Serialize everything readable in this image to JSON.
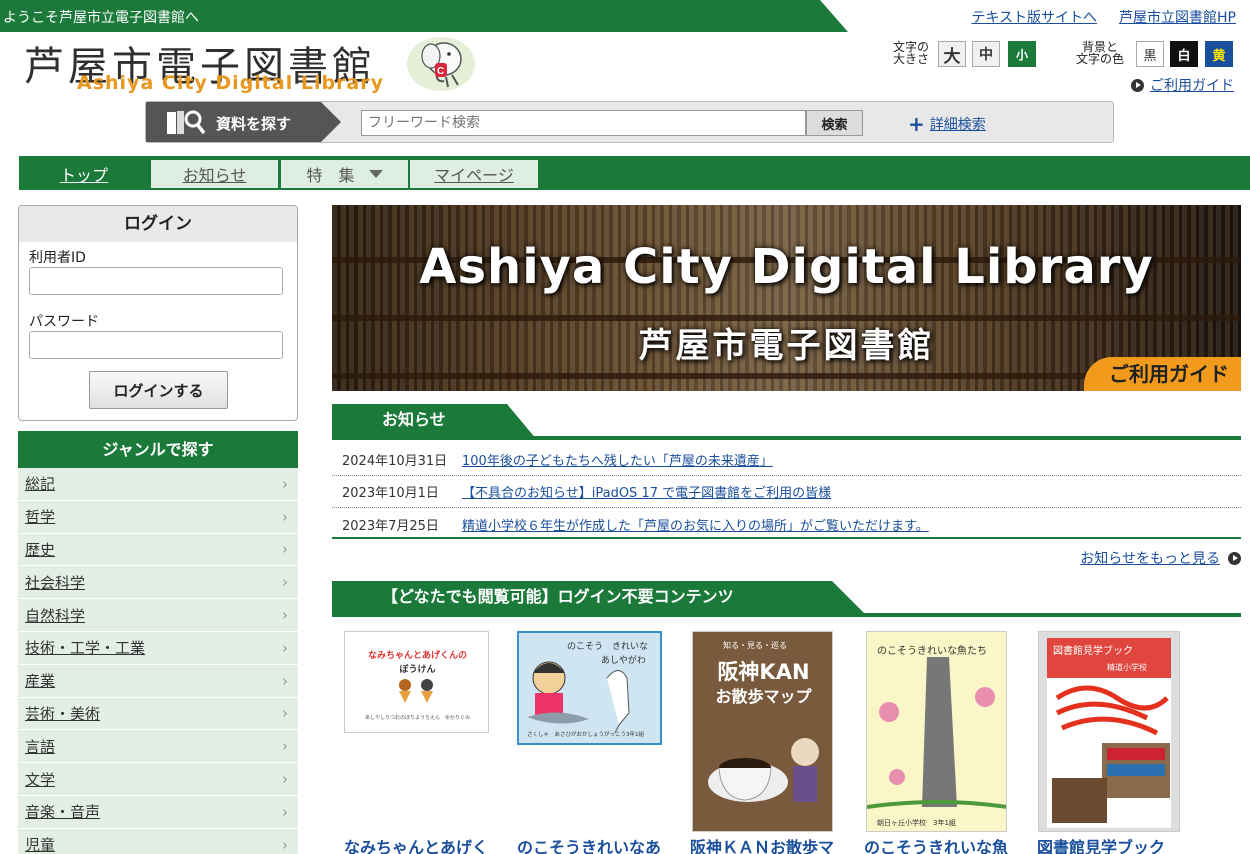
{
  "header": {
    "welcome": "ようこそ芦屋市立電子図書館へ",
    "links": [
      "テキスト版サイトへ",
      "芦屋市立図書館HP"
    ],
    "logo_jp": "芦屋市電子図書館",
    "logo_en": "Ashiya City Digital Library"
  },
  "display_controls": {
    "size_label_1": "文字の",
    "size_label_2": "大きさ",
    "sizes": [
      "大",
      "中",
      "小"
    ],
    "color_label_1": "背景と",
    "color_label_2": "文字の色",
    "colors": [
      "黒",
      "白",
      "黄"
    ],
    "guide": "ご利用ガイド"
  },
  "search": {
    "label": "資料を探す",
    "placeholder": "フリーワード検索",
    "button": "検索",
    "advanced": "詳細検索"
  },
  "nav": {
    "tabs": [
      "トップ",
      "お知らせ",
      "特　集",
      "マイページ"
    ]
  },
  "login": {
    "title": "ログイン",
    "user_id_label": "利用者ID",
    "password_label": "パスワード",
    "button": "ログインする"
  },
  "genre": {
    "title": "ジャンルで探す",
    "items": [
      "総記",
      "哲学",
      "歴史",
      "社会科学",
      "自然科学",
      "技術・工学・工業",
      "産業",
      "芸術・美術",
      "言語",
      "文学",
      "音楽・音声",
      "児童"
    ]
  },
  "banner": {
    "title": "Ashiya City Digital Library",
    "subtitle": "芦屋市電子図書館",
    "guide": "ご利用ガイド"
  },
  "news": {
    "title": "お知らせ",
    "items": [
      {
        "date": "2024年10月31日",
        "text": "100年後の子どもたちへ残したい「芦屋の未来遺産」"
      },
      {
        "date": "2023年10月1日",
        "text": "【不具合のお知らせ】iPadOS 17 で電子図書館をご利用の皆様"
      },
      {
        "date": "2023年7月25日",
        "text": "精道小学校６年生が作成した「芦屋のお気に入りの場所」がご覧いただけます。"
      }
    ],
    "more": "お知らせをもっと見る"
  },
  "contents": {
    "title": "【どなたでも閲覧可能】ログイン不要コンテンツ",
    "cards": [
      {
        "title": "なみちゃんとあげく",
        "cover_title": "なみちゃんとあげくんの",
        "cover_title2": "ぼうけん",
        "cover_sub": "あしやしりつおのぼりようちえん　ゆかりぐみ"
      },
      {
        "title": "のこそうきれいなあ",
        "cover_title": "のこそう　きれいな",
        "cover_title2": "あしやがわ",
        "cover_sub": "さくしゃ　あさひがおかしょうがっこう3年1組"
      },
      {
        "title": "阪神ＫＡＮお散歩マ",
        "cover_title": "阪神KAN",
        "cover_title2": "お散歩マップ",
        "cover_sub": "知る・見る・巡る"
      },
      {
        "title": "のこそうきれいな魚",
        "cover_title": "のこそうきれいな魚たち",
        "cover_title2": "",
        "cover_sub": "朝日ヶ丘小学校　3年1組"
      },
      {
        "title": "図書館見学ブック",
        "cover_title": "図書館見学ブック",
        "cover_title2": "",
        "cover_sub": "精道小学校"
      }
    ]
  },
  "colors": {
    "primary_green": "#1b7a3a",
    "light_green": "#e3efe6",
    "link_blue": "#1a4f9c",
    "accent_orange": "#f29a1c",
    "logo_orange": "#e8981f"
  }
}
